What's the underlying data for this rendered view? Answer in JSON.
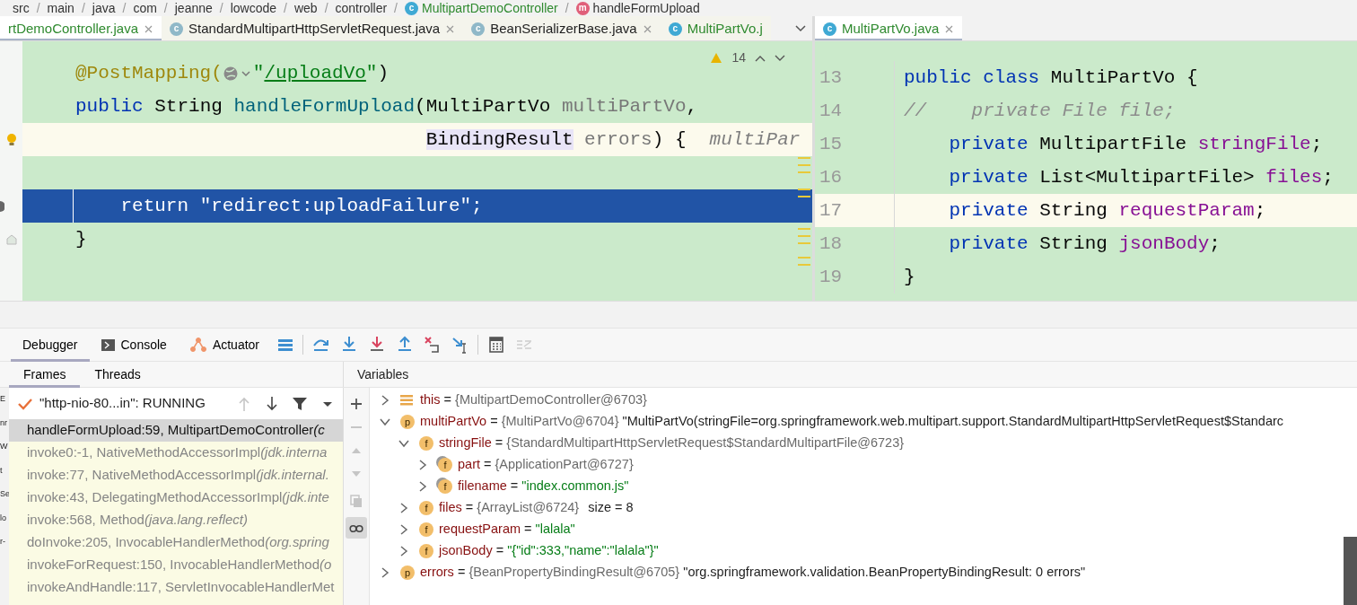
{
  "breadcrumbs": [
    {
      "text": "src",
      "kind": "folder"
    },
    {
      "sep": "/",
      "text": "main",
      "kind": "folder"
    },
    {
      "sep": "/",
      "text": "java",
      "kind": "folder"
    },
    {
      "sep": "/",
      "text": "com",
      "kind": "folder"
    },
    {
      "sep": "/",
      "text": "jeanne",
      "kind": "folder"
    },
    {
      "sep": "/",
      "text": "lowcode",
      "kind": "folder"
    },
    {
      "sep": "/",
      "text": "web",
      "kind": "folder"
    },
    {
      "sep": "/",
      "text": "controller",
      "kind": "folder"
    },
    {
      "sep": "/",
      "text": "MultipartDemoController",
      "kind": "class",
      "icon": "c"
    },
    {
      "sep": "/",
      "text": "handleFormUpload",
      "kind": "method",
      "icon": "m"
    }
  ],
  "editor_tabs": [
    {
      "label": "rtDemoController.java",
      "selected": true,
      "color": "#2f8a2f",
      "closable": true
    },
    {
      "label": "StandardMultipartHttpServletRequest.java",
      "icon": "c",
      "kind": "library-class",
      "selected": false,
      "color": "#1e1e1e",
      "closable": true
    },
    {
      "label": "BeanSerializerBase.java",
      "icon": "c",
      "kind": "library-class",
      "selected": false,
      "color": "#1e1e1e",
      "closable": true
    },
    {
      "label": "MultiPartVo.j",
      "icon": "c",
      "kind": "class",
      "selected": false,
      "color": "#2f8a2f",
      "closable": false
    }
  ],
  "split_tabs": [
    {
      "label": "MultiPartVo.java",
      "icon": "c",
      "kind": "class",
      "selected": true,
      "color": "#2f8a2f",
      "closable": true
    }
  ],
  "left_editor": {
    "warnings": "14",
    "lines": [
      {
        "kind": "plain",
        "tokens": [
          {
            "text": "@PostMapping(",
            "kind": "annotation"
          },
          {
            "kind": "globe-icon"
          },
          {
            "text": "\"",
            "kind": "string"
          },
          {
            "text": "/uploadVo",
            "kind": "url"
          },
          {
            "text": "\"",
            "kind": "string"
          },
          {
            "text": ")",
            "kind": "plain"
          }
        ]
      },
      {
        "kind": "plain",
        "tokens": [
          {
            "text": "public ",
            "kind": "keyword"
          },
          {
            "text": "String ",
            "kind": "plain"
          },
          {
            "text": "handleFormUpload",
            "kind": "method"
          },
          {
            "text": "(MultiPartVo ",
            "kind": "plain"
          },
          {
            "text": "multiPartVo",
            "kind": "param"
          },
          {
            "text": ",",
            "kind": "plain"
          }
        ]
      },
      {
        "kind": "current",
        "bulb": true,
        "tokens": [
          {
            "text": "                               BindingResult",
            "kind": "type-highlighted"
          },
          {
            "text": " errors",
            "kind": "param"
          },
          {
            "text": ") {",
            "kind": "plain"
          },
          {
            "text": "multiPar",
            "kind": "hint"
          }
        ]
      },
      {
        "kind": "plain"
      },
      {
        "kind": "execution",
        "breakpoint": true,
        "tokens": [
          {
            "text": "    return ",
            "kind": "plain"
          },
          {
            "text": "\"redirect:uploadFailure\"",
            "kind": "plain"
          },
          {
            "text": ";",
            "kind": "plain"
          }
        ]
      },
      {
        "kind": "plain",
        "fold": true,
        "tokens": [
          {
            "text": "}",
            "kind": "plain"
          }
        ]
      },
      {
        "kind": "plain"
      }
    ]
  },
  "right_editor": {
    "lines": [
      {
        "number": "13",
        "current": false,
        "tokens": [
          {
            "text": "public class ",
            "kind": "keyword"
          },
          {
            "text": "MultiPartVo {",
            "kind": "plain"
          }
        ]
      },
      {
        "number": "14",
        "current": false,
        "tokens": [
          {
            "text": "//    private File file;",
            "kind": "comment"
          }
        ]
      },
      {
        "number": "15",
        "current": false,
        "tokens": [
          {
            "text": "    private ",
            "kind": "keyword"
          },
          {
            "text": "MultipartFile ",
            "kind": "plain"
          },
          {
            "text": "stringFile",
            "kind": "field"
          },
          {
            "text": ";",
            "kind": "plain"
          }
        ]
      },
      {
        "number": "16",
        "current": false,
        "tokens": [
          {
            "text": "    private ",
            "kind": "keyword"
          },
          {
            "text": "List<MultipartFile> ",
            "kind": "plain"
          },
          {
            "text": "files",
            "kind": "field"
          },
          {
            "text": ";",
            "kind": "plain"
          }
        ]
      },
      {
        "number": "17",
        "current": true,
        "tokens": [
          {
            "text": "    private ",
            "kind": "keyword"
          },
          {
            "text": "String ",
            "kind": "plain"
          },
          {
            "text": "requestParam",
            "kind": "field"
          },
          {
            "text": ";",
            "kind": "plain"
          }
        ]
      },
      {
        "number": "18",
        "current": false,
        "tokens": [
          {
            "text": "    private ",
            "kind": "keyword"
          },
          {
            "text": "String ",
            "kind": "plain"
          },
          {
            "text": "jsonBody",
            "kind": "field"
          },
          {
            "text": ";",
            "kind": "plain"
          }
        ]
      },
      {
        "number": "19",
        "current": false,
        "tokens": [
          {
            "text": "}",
            "kind": "plain"
          }
        ]
      }
    ]
  },
  "side_fragments": [
    "E",
    "nr",
    "W",
    "t",
    "Se",
    "lo",
    "r-"
  ],
  "debug_tabs": [
    {
      "label": "Debugger",
      "selected": true
    },
    {
      "label": "Console",
      "kind": "console",
      "selected": false
    },
    {
      "label": "Actuator",
      "kind": "actuator",
      "selected": false
    }
  ],
  "debug_actions": [
    {
      "kind": "layout",
      "disabled": false
    },
    {
      "kind": "step-over",
      "disabled": false
    },
    {
      "kind": "step-into",
      "disabled": false
    },
    {
      "kind": "force-step-into",
      "disabled": false
    },
    {
      "kind": "step-out",
      "disabled": false
    },
    {
      "kind": "drop-frame",
      "disabled": false
    },
    {
      "kind": "run-to-cursor",
      "disabled": false
    },
    {
      "kind": "evaluate",
      "disabled": false
    },
    {
      "kind": "trace",
      "disabled": true
    }
  ],
  "frames_tabs": [
    {
      "label": "Frames",
      "selected": true
    },
    {
      "label": "Threads",
      "selected": false
    }
  ],
  "variables_title": "Variables",
  "thread": {
    "label": "\"http-nio-80...in\": RUNNING",
    "actions": [
      {
        "kind": "up",
        "disabled": true
      },
      {
        "kind": "down",
        "disabled": false
      },
      {
        "kind": "filter",
        "disabled": false
      },
      {
        "kind": "menu",
        "disabled": false
      }
    ]
  },
  "frames": [
    {
      "text": "handleFormUpload:59, MultipartDemoController",
      "package": "(c",
      "library": false,
      "selected": true
    },
    {
      "text": "invoke0:-1, NativeMethodAccessorImpl",
      "package": "(jdk.interna",
      "library": true,
      "selected": false
    },
    {
      "text": "invoke:77, NativeMethodAccessorImpl",
      "package": "(jdk.internal.",
      "library": true,
      "selected": false
    },
    {
      "text": "invoke:43, DelegatingMethodAccessorImpl",
      "package": "(jdk.inte",
      "library": true,
      "selected": false
    },
    {
      "text": "invoke:568, Method",
      "package": "(java.lang.reflect)",
      "library": true,
      "selected": false
    },
    {
      "text": "doInvoke:205, InvocableHandlerMethod",
      "package": "(org.spring",
      "library": true,
      "selected": false
    },
    {
      "text": "invokeForRequest:150, InvocableHandlerMethod",
      "package": "(o",
      "library": true,
      "selected": false
    },
    {
      "text": "invokeAndHandle:117, ServletInvocableHandlerMet",
      "library": true,
      "selected": false
    }
  ],
  "variable_actions": [
    {
      "kind": "add",
      "disabled": false,
      "on": false
    },
    {
      "kind": "remove",
      "disabled": true,
      "on": false
    },
    {
      "kind": "up",
      "disabled": true,
      "on": false
    },
    {
      "kind": "down",
      "disabled": true,
      "on": false
    },
    {
      "kind": "copy",
      "disabled": true,
      "on": false
    },
    {
      "kind": "watches",
      "disabled": false,
      "on": true
    }
  ],
  "variables": [
    {
      "kind": "this",
      "name": "this",
      "op": "=",
      "ref": "{MultipartDemoController@6703}",
      "expanded": false
    },
    {
      "kind": "param",
      "badge": "p",
      "name": "multiPartVo",
      "op": "=",
      "ref": "{MultiPartVo@6704}",
      "value": "\"MultiPartVo(stringFile=org.springframework.web.multipart.support.StandardMultipartHttpServletRequest$Standarc",
      "string_value": false,
      "expanded": true,
      "children": [
        {
          "kind": "field",
          "badge": "f",
          "name": "stringFile",
          "op": "=",
          "ref": "{StandardMultipartHttpServletRequest$StandardMultipartFile@6723}",
          "expanded": true,
          "children": [
            {
              "kind": "final-field",
              "badge": "f",
              "name": "part",
              "op": "=",
              "ref": "{ApplicationPart@6727}",
              "expanded": false
            },
            {
              "kind": "final-field",
              "badge": "f",
              "name": "filename",
              "op": "=",
              "value": "\"index.common.js\"",
              "string_value": true,
              "expanded": false
            }
          ]
        },
        {
          "kind": "field",
          "badge": "f",
          "name": "files",
          "op": "=",
          "ref": "{ArrayList@6724}",
          "extra": "size = 8",
          "expanded": false
        },
        {
          "kind": "field",
          "badge": "f",
          "name": "requestParam",
          "op": "=",
          "value": "\"lalala\"",
          "string_value": true,
          "expanded": false
        },
        {
          "kind": "field",
          "badge": "f",
          "name": "jsonBody",
          "op": "=",
          "value": "\"{\"id\":333,\"name\":\"lalala\"}\"",
          "string_value": true,
          "expanded": false
        }
      ]
    },
    {
      "kind": "param",
      "badge": "p",
      "name": "errors",
      "op": "=",
      "ref": "{BeanPropertyBindingResult@6705}",
      "value": "\"org.springframework.validation.BeanPropertyBindingResult: 0 errors\"",
      "string_value": false,
      "expanded": false
    }
  ]
}
